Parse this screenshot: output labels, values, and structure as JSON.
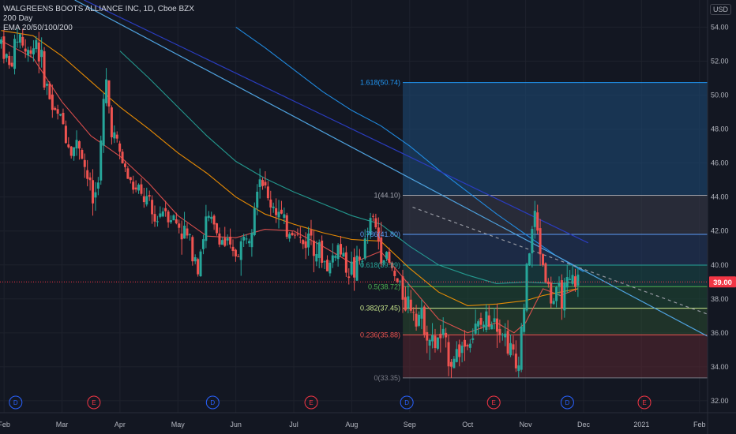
{
  "header": {
    "symbol_line": "WALGREENS BOOTS ALLIANCE INC, 1D, Cboe BZX",
    "indicator_1": "200 Day",
    "indicator_2": "EMA 20/50/100/200",
    "currency": "USD"
  },
  "colors": {
    "background": "#131722",
    "up": "#26a69a",
    "down": "#ef5350",
    "ema20": "#ef5350",
    "ema50": "#ff9800",
    "ema100": "#26a69a",
    "ema200": "#2196f3",
    "trend_navy": "#2a3cbf",
    "trend_light": "#4fa3e0",
    "current_price_bg": "#f23645"
  },
  "chart_data": {
    "type": "candlestick",
    "title": "WALGREENS BOOTS ALLIANCE INC, 1D, Cboe BZX",
    "xlabel": "",
    "ylabel": "",
    "x_tick_labels": [
      "Feb",
      "Mar",
      "Apr",
      "May",
      "Jun",
      "Jul",
      "Aug",
      "Sep",
      "Oct",
      "Nov",
      "Dec",
      "2021",
      "Feb"
    ],
    "x_tick_months": [
      1,
      2,
      3,
      4,
      5,
      6,
      7,
      8,
      9,
      10,
      11,
      12,
      13
    ],
    "y_ticks": [
      32.0,
      34.0,
      36.0,
      38.0,
      40.0,
      42.0,
      44.0,
      46.0,
      48.0,
      50.0,
      52.0,
      54.0
    ],
    "ylim": [
      31.3,
      55.6
    ],
    "xlim_months": [
      0.93,
      13.14
    ],
    "current_price": "39.00",
    "current_price_value": 39.0,
    "price_series": {
      "months": [
        0.95,
        1.1,
        1.25,
        1.4,
        1.55,
        1.7,
        1.85,
        2.0,
        2.15,
        2.3,
        2.45,
        2.55,
        2.65,
        2.75,
        2.85,
        3.0,
        3.15,
        3.3,
        3.45,
        3.6,
        3.75,
        3.9,
        4.05,
        4.2,
        4.35,
        4.5,
        4.65,
        4.8,
        4.95,
        5.1,
        5.25,
        5.4,
        5.55,
        5.7,
        5.85,
        6.0,
        6.15,
        6.3,
        6.45,
        6.6,
        6.75,
        6.9,
        7.05,
        7.2,
        7.35,
        7.5,
        7.65,
        7.8,
        7.95,
        8.1,
        8.25,
        8.4,
        8.55,
        8.7,
        8.85,
        9.0,
        9.15,
        9.3,
        9.45,
        9.6,
        9.75,
        9.85,
        9.95,
        10.05,
        10.15,
        10.3,
        10.45,
        10.6,
        10.7,
        10.8,
        10.95
      ],
      "close": [
        53.2,
        51.5,
        53.8,
        52.3,
        53.4,
        51.0,
        49.0,
        48.5,
        46.8,
        47.2,
        45.0,
        43.5,
        46.0,
        51.0,
        48.2,
        46.5,
        45.0,
        44.2,
        43.8,
        42.5,
        43.5,
        42.8,
        42.2,
        41.4,
        40.2,
        42.8,
        42.0,
        41.3,
        40.5,
        41.2,
        42.3,
        45.6,
        43.8,
        43.4,
        42.0,
        42.2,
        41.2,
        41.9,
        40.6,
        39.8,
        41.2,
        40.0,
        39.6,
        40.7,
        42.9,
        41.0,
        40.0,
        38.8,
        37.9,
        37.4,
        36.6,
        35.2,
        35.8,
        34.4,
        35.0,
        35.5,
        36.2,
        36.6,
        37.3,
        36.1,
        35.0,
        33.7,
        37.0,
        40.5,
        43.0,
        40.0,
        37.8,
        38.2,
        38.5,
        39.0,
        39.1
      ]
    },
    "moving_averages": [
      {
        "months": [
          0.95,
          1.5,
          2.0,
          2.5,
          3.0,
          3.5,
          4.0,
          4.5,
          5.0,
          5.5,
          6.0,
          6.5,
          7.0,
          7.5,
          8.0,
          8.5,
          9.0,
          9.5,
          9.8,
          10.0,
          10.3,
          10.6,
          10.9
        ],
        "values": [
          53.2,
          52.2,
          49.6,
          47.6,
          46.4,
          44.8,
          42.9,
          41.7,
          41.6,
          42.1,
          42.0,
          41.1,
          40.1,
          40.8,
          38.8,
          36.8,
          36.0,
          36.6,
          36.0,
          36.6,
          38.6,
          38.2,
          38.6
        ]
      },
      {
        "months": [
          0.95,
          1.5,
          2.0,
          2.5,
          3.0,
          3.5,
          4.0,
          4.5,
          5.0,
          5.5,
          6.0,
          6.5,
          7.0,
          7.5,
          8.0,
          8.5,
          9.0,
          9.5,
          10.0,
          10.3,
          10.6,
          10.9
        ],
        "values": [
          53.8,
          53.5,
          52.3,
          50.8,
          49.3,
          48.0,
          46.6,
          45.4,
          44.0,
          43.0,
          42.4,
          41.9,
          41.5,
          41.4,
          39.8,
          38.4,
          37.6,
          37.7,
          37.9,
          38.2,
          38.4,
          38.6
        ]
      },
      {
        "months": [
          3.0,
          3.5,
          4.0,
          4.5,
          5.0,
          5.5,
          6.0,
          6.5,
          7.0,
          7.5,
          8.0,
          8.5,
          9.0,
          9.5,
          10.0,
          10.5,
          10.9
        ],
        "values": [
          52.6,
          51.0,
          49.3,
          47.6,
          46.1,
          45.1,
          44.3,
          43.6,
          42.9,
          42.4,
          41.1,
          40.0,
          39.4,
          38.9,
          39.0,
          38.9,
          39.0
        ]
      },
      {
        "months": [
          5.0,
          5.5,
          6.0,
          6.5,
          7.0,
          7.5,
          8.0,
          8.5,
          9.0,
          9.5,
          10.0,
          10.5,
          11.0
        ],
        "values": [
          54.0,
          52.8,
          51.5,
          50.2,
          49.1,
          48.2,
          47.0,
          45.6,
          44.3,
          43.0,
          41.8,
          40.6,
          39.6
        ]
      }
    ],
    "trendlines": [
      {
        "name": "navy-trendline",
        "style": "solid",
        "from": [
          2.38,
          55.6
        ],
        "to": [
          11.08,
          41.3
        ]
      },
      {
        "name": "light-trendline",
        "style": "solid",
        "from": [
          2.22,
          55.6
        ],
        "to": [
          13.14,
          35.8
        ]
      },
      {
        "name": "dashed-trendline",
        "style": "dashed",
        "from": [
          8.05,
          43.4
        ],
        "to": [
          13.14,
          37.1
        ]
      }
    ],
    "fibonacci": {
      "start_month": 7.88,
      "end_month": 13.14,
      "levels": [
        {
          "label": "1.618(50.74)",
          "value": 50.74,
          "color": "#2196f3",
          "fill": "#1e4d7a"
        },
        {
          "label": "1(44.10)",
          "value": 44.1,
          "color": "#a0a3ad",
          "fill": "#3a3d4a"
        },
        {
          "label": "0.786(41.80)",
          "value": 41.8,
          "color": "#5b9cf6",
          "fill": "#243b63"
        },
        {
          "label": "0.618(39.99)",
          "value": 39.99,
          "color": "#26a69a",
          "fill": "#1a4a4a"
        },
        {
          "label": "0.5(38.72)",
          "value": 38.72,
          "color": "#4caf50",
          "fill": "#1f4a35"
        },
        {
          "label": "0.382(37.45)",
          "value": 37.45,
          "color": "#c8e68c",
          "fill": "#2a4a2f"
        },
        {
          "label": "0.236(35.88)",
          "value": 35.88,
          "color": "#ef5350",
          "fill": "#5a2630"
        },
        {
          "label": "0(33.35)",
          "value": 33.35,
          "color": "#787b86",
          "fill": ""
        }
      ]
    },
    "event_markers": [
      {
        "label": "D",
        "month": 1.2,
        "kind": "dividend"
      },
      {
        "label": "E",
        "month": 2.55,
        "kind": "earnings"
      },
      {
        "label": "D",
        "month": 4.6,
        "kind": "dividend"
      },
      {
        "label": "E",
        "month": 6.3,
        "kind": "earnings"
      },
      {
        "label": "D",
        "month": 7.95,
        "kind": "dividend"
      },
      {
        "label": "E",
        "month": 9.45,
        "kind": "earnings"
      },
      {
        "label": "D",
        "month": 10.72,
        "kind": "dividend"
      },
      {
        "label": "E",
        "month": 12.05,
        "kind": "earnings"
      }
    ],
    "grid": true
  }
}
